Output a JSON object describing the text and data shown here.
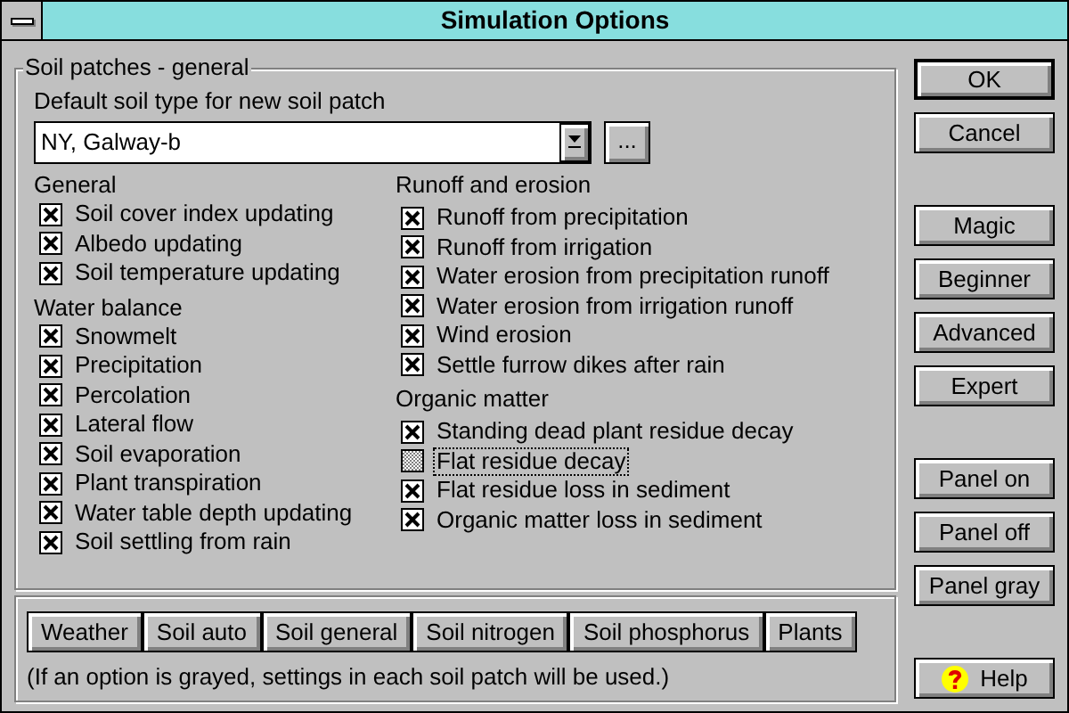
{
  "window": {
    "title": "Simulation Options"
  },
  "group": {
    "title": "Soil patches - general",
    "soil_type_label": "Default soil type for new soil patch",
    "soil_type": {
      "value": "NY, Galway-b",
      "browse": "..."
    },
    "columns": [
      [
        {
          "heading": "General",
          "options": [
            {
              "label": "Soil cover index updating",
              "checked": true,
              "focused": false
            },
            {
              "label": "Albedo updating",
              "checked": true,
              "focused": false
            },
            {
              "label": "Soil temperature updating",
              "checked": true,
              "focused": false
            }
          ]
        },
        {
          "heading": "Water balance",
          "options": [
            {
              "label": "Snowmelt",
              "checked": true,
              "focused": false
            },
            {
              "label": "Precipitation",
              "checked": true,
              "focused": false
            },
            {
              "label": "Percolation",
              "checked": true,
              "focused": false
            },
            {
              "label": "Lateral flow",
              "checked": true,
              "focused": false
            },
            {
              "label": "Soil evaporation",
              "checked": true,
              "focused": false
            },
            {
              "label": "Plant transpiration",
              "checked": true,
              "focused": false
            },
            {
              "label": "Water table depth updating",
              "checked": true,
              "focused": false
            },
            {
              "label": "Soil settling from rain",
              "checked": true,
              "focused": false
            }
          ]
        }
      ],
      [
        {
          "heading": "Runoff and erosion",
          "options": [
            {
              "label": "Runoff from precipitation",
              "checked": true,
              "focused": false
            },
            {
              "label": "Runoff from irrigation",
              "checked": true,
              "focused": false
            },
            {
              "label": "Water erosion from precipitation runoff",
              "checked": true,
              "focused": false
            },
            {
              "label": "Water erosion from irrigation runoff",
              "checked": true,
              "focused": false
            },
            {
              "label": "Wind erosion",
              "checked": true,
              "focused": false
            },
            {
              "label": "Settle furrow dikes after rain",
              "checked": true,
              "focused": false
            }
          ]
        },
        {
          "heading": "Organic matter",
          "options": [
            {
              "label": "Standing dead plant residue decay",
              "checked": true,
              "focused": false
            },
            {
              "label": "Flat residue decay",
              "grayed": true,
              "focused": true
            },
            {
              "label": "Flat residue loss in sediment",
              "checked": true,
              "focused": false
            },
            {
              "label": "Organic matter loss in sediment",
              "checked": true,
              "focused": false
            }
          ]
        }
      ]
    ]
  },
  "panel_buttons": [
    {
      "label": "Weather"
    },
    {
      "label": "Soil auto"
    },
    {
      "label": "Soil general"
    },
    {
      "label": "Soil nitrogen"
    },
    {
      "label": "Soil phosphorus"
    },
    {
      "label": "Plants"
    }
  ],
  "note": "(If an option is grayed, settings in each soil patch will be used.)",
  "side_button_groups": [
    [
      {
        "label": "OK",
        "default": true,
        "kind": "plain"
      },
      {
        "label": "Cancel",
        "default": false,
        "kind": "plain"
      }
    ],
    [
      {
        "label": "Magic",
        "default": false,
        "kind": "plain"
      },
      {
        "label": "Beginner",
        "default": false,
        "kind": "plain"
      },
      {
        "label": "Advanced",
        "default": false,
        "kind": "plain"
      },
      {
        "label": "Expert",
        "default": false,
        "kind": "plain"
      }
    ],
    [
      {
        "label": "Panel on",
        "default": false,
        "kind": "plain"
      },
      {
        "label": "Panel off",
        "default": false,
        "kind": "plain"
      },
      {
        "label": "Panel gray",
        "default": false,
        "kind": "plain"
      }
    ],
    [
      {
        "label": "Help",
        "default": false,
        "kind": "help"
      }
    ]
  ]
}
